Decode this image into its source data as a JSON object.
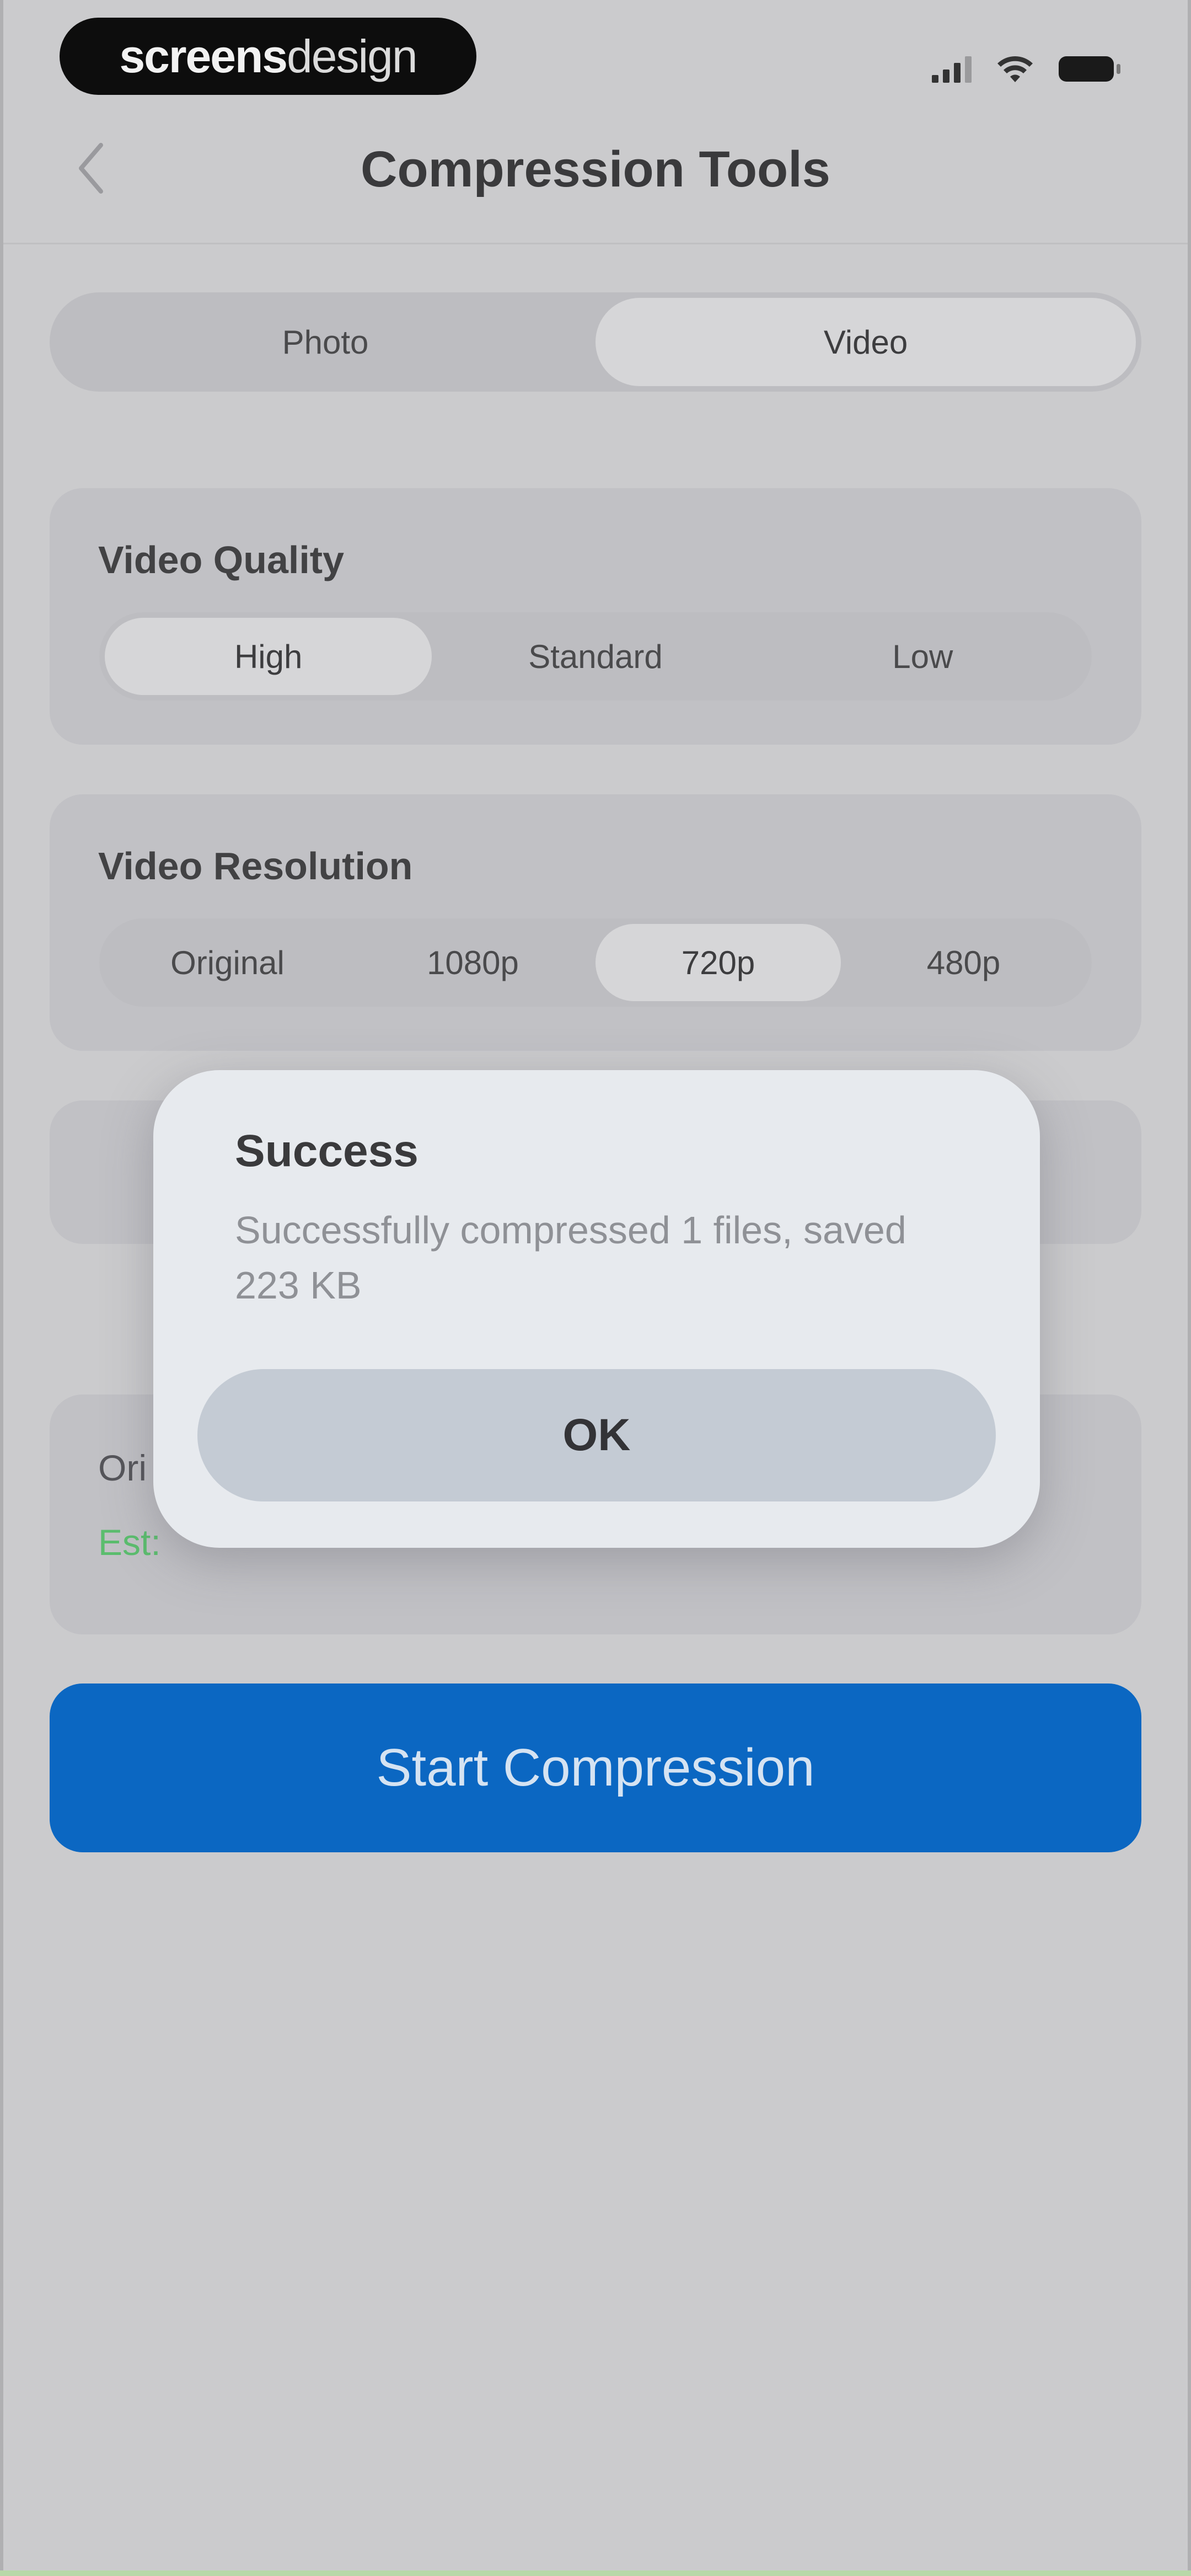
{
  "status_bar": {
    "logo_part1": "screens",
    "logo_part2": "design"
  },
  "header": {
    "title": "Compression Tools"
  },
  "media_tabs": {
    "options": [
      "Photo",
      "Video"
    ],
    "selected": "Video"
  },
  "video_quality": {
    "title": "Video Quality",
    "options": [
      "High",
      "Standard",
      "Low"
    ],
    "selected": "High"
  },
  "video_resolution": {
    "title": "Video Resolution",
    "options": [
      "Original",
      "1080p",
      "720p",
      "480p"
    ],
    "selected": "720p"
  },
  "info": {
    "original_prefix": "Ori",
    "est_prefix": "Est:"
  },
  "cta": {
    "label": "Start Compression"
  },
  "dialog": {
    "title": "Success",
    "message": "Successfully compressed 1 files, saved 223 KB",
    "ok_label": "OK"
  },
  "colors": {
    "accent": "#0b67c2",
    "success_text": "#5bbd6e"
  }
}
